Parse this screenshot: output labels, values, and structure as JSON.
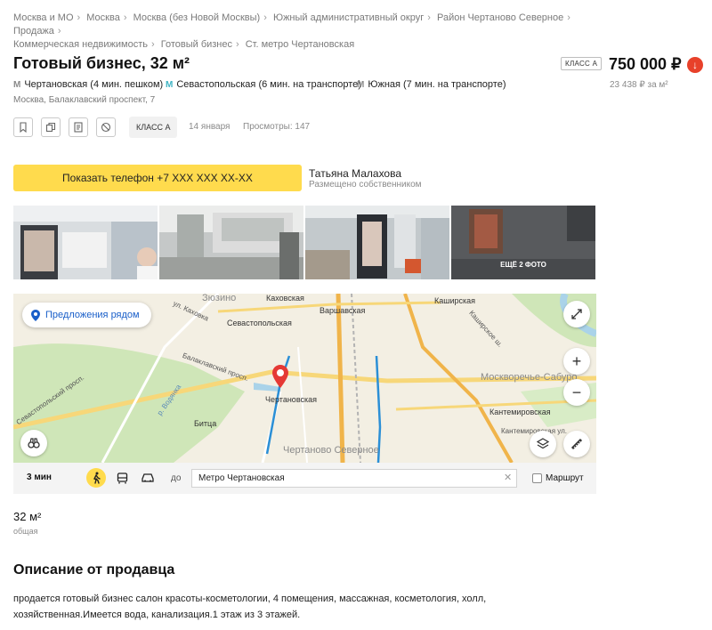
{
  "breadcrumbs": [
    "Москва и МО",
    "Москва",
    "Москва (без Новой Москвы)",
    "Южный административный округ",
    "Район Чертаново Северное",
    "Продажа",
    "Коммерческая недвижимость",
    "Готовый бизнес",
    "Ст. метро Чертановская"
  ],
  "listing": {
    "title": "Готовый бизнес, 32 м²",
    "class_badge": "КЛАСС А",
    "price": "750 000 ₽",
    "price_per_m2": "23 438 ₽ за м²",
    "metro": [
      {
        "icon": "metro-icon",
        "text": "Чертановская (4 мин. пешком)",
        "color": "#888888"
      },
      {
        "icon": "metro-icon",
        "text": "Севастопольская (6 мин. на транспорте)",
        "color": "#3fb4c4"
      },
      {
        "icon": "metro-icon",
        "text": "Южная (7 мин. на транспорте)",
        "color": "#888888"
      }
    ],
    "address": "Москва, Балаклавский проспект, 7",
    "class_tag": "КЛАСС А",
    "date": "14 января",
    "views": "Просмотры: 147"
  },
  "contact": {
    "phone_button": "Показать телефон +7 XXX XXX XX-XX",
    "seller_name": "Татьяна Малахова",
    "seller_type": "Размещено собственником"
  },
  "gallery": {
    "more_label": "ЕЩЁ 2 ФОТО"
  },
  "map": {
    "nearby_button": "Предложения рядом",
    "labels": {
      "zyuzino": "Зюзино",
      "kakhovskaya": "Каховская",
      "varshavskaya": "Варшавская",
      "kashirskaya": "Каширская",
      "sevastopolskaya": "Севастопольская",
      "chertanovskaya": "Чертановская",
      "kantemirovskaya": "Кантемировская",
      "moskvorechye": "Москворечье-Сабуро",
      "chertanovo_sev": "Чертаново Северное",
      "bitsa": "Битца",
      "street_kakhovka": "ул. Каховка",
      "street_balaklava": "Балаклавский просп.",
      "street_sevastopol": "Севастопольский просп.",
      "street_kashira": "Каширское ш.",
      "street_kantemir": "Кантемировская ул.",
      "river_bitsa": "р. Водянка"
    }
  },
  "route": {
    "time": "3 мин",
    "to_label": "до",
    "destination": "Метро Чертановская",
    "route_label": "Маршрут",
    "modes": [
      "walk-icon",
      "bus-icon",
      "car-icon"
    ]
  },
  "area": {
    "value": "32 м²",
    "label": "общая"
  },
  "description": {
    "title": "Описание от продавца",
    "text": "продается готовый бизнес салон красоты-косметологии, 4 помещения, массажная, косметология, холл, хозяйственная.Имеется вода, канализация.1 этаж из 3 этажей."
  },
  "colors": {
    "accent_yellow": "#ffdb4d",
    "price_down": "#e8412a",
    "link_blue": "#1a5fc9",
    "map_pin": "#e53935"
  }
}
